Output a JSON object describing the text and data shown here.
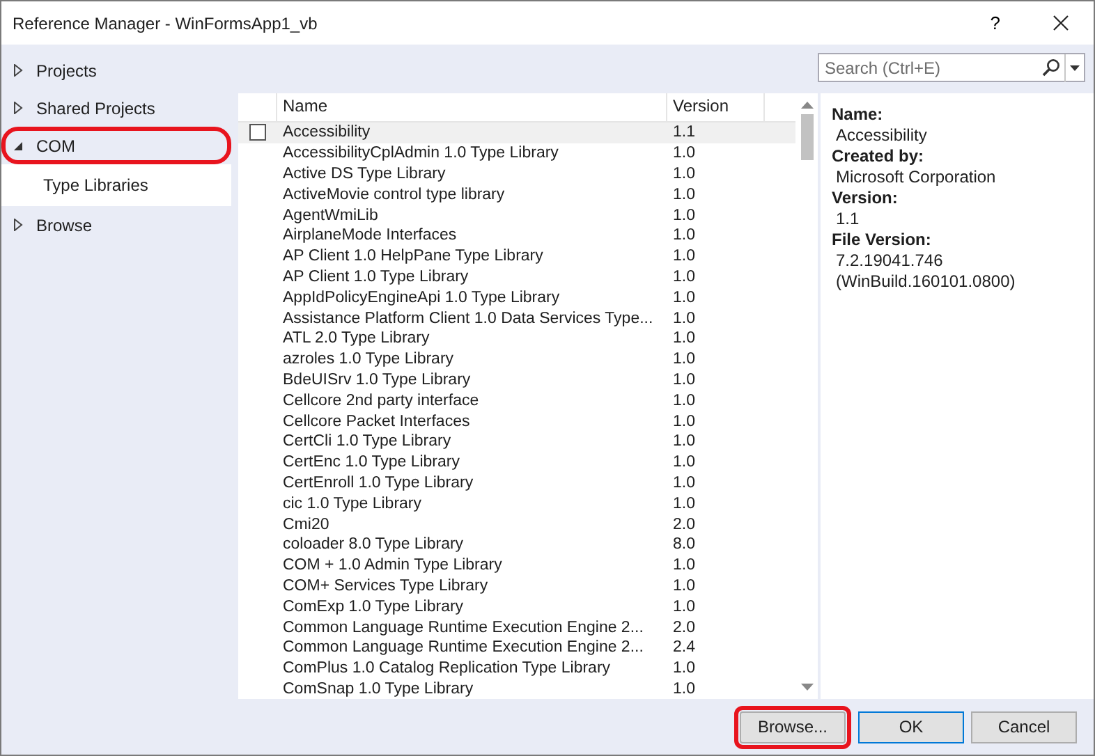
{
  "window": {
    "title": "Reference Manager - WinFormsApp1_vb",
    "help": "?"
  },
  "sidebar": {
    "items": [
      {
        "label": "Projects",
        "expanded": false,
        "highlighted": false
      },
      {
        "label": "Shared Projects",
        "expanded": false,
        "highlighted": false
      },
      {
        "label": "COM",
        "expanded": true,
        "highlighted": true,
        "children": [
          {
            "label": "Type Libraries",
            "selected": true
          }
        ]
      },
      {
        "label": "Browse",
        "expanded": false,
        "highlighted": false
      }
    ]
  },
  "search": {
    "placeholder": "Search (Ctrl+E)"
  },
  "table": {
    "columns": [
      "Name",
      "Version"
    ],
    "rows": [
      {
        "name": "Accessibility",
        "version": "1.1",
        "selected": true
      },
      {
        "name": "AccessibilityCplAdmin 1.0 Type Library",
        "version": "1.0",
        "selected": false
      },
      {
        "name": "Active DS Type Library",
        "version": "1.0",
        "selected": false
      },
      {
        "name": "ActiveMovie control type library",
        "version": "1.0",
        "selected": false
      },
      {
        "name": "AgentWmiLib",
        "version": "1.0",
        "selected": false
      },
      {
        "name": "AirplaneMode Interfaces",
        "version": "1.0",
        "selected": false
      },
      {
        "name": "AP Client 1.0 HelpPane Type Library",
        "version": "1.0",
        "selected": false
      },
      {
        "name": "AP Client 1.0 Type Library",
        "version": "1.0",
        "selected": false
      },
      {
        "name": "AppIdPolicyEngineApi 1.0 Type Library",
        "version": "1.0",
        "selected": false
      },
      {
        "name": "Assistance Platform Client 1.0 Data Services Type...",
        "version": "1.0",
        "selected": false
      },
      {
        "name": "ATL 2.0 Type Library",
        "version": "1.0",
        "selected": false
      },
      {
        "name": "azroles 1.0 Type Library",
        "version": "1.0",
        "selected": false
      },
      {
        "name": "BdeUISrv 1.0 Type Library",
        "version": "1.0",
        "selected": false
      },
      {
        "name": "Cellcore 2nd party interface",
        "version": "1.0",
        "selected": false
      },
      {
        "name": "Cellcore Packet Interfaces",
        "version": "1.0",
        "selected": false
      },
      {
        "name": "CertCli 1.0 Type Library",
        "version": "1.0",
        "selected": false
      },
      {
        "name": "CertEnc 1.0 Type Library",
        "version": "1.0",
        "selected": false
      },
      {
        "name": "CertEnroll 1.0 Type Library",
        "version": "1.0",
        "selected": false
      },
      {
        "name": "cic 1.0 Type Library",
        "version": "1.0",
        "selected": false
      },
      {
        "name": "Cmi20",
        "version": "2.0",
        "selected": false
      },
      {
        "name": "coloader 8.0 Type Library",
        "version": "8.0",
        "selected": false
      },
      {
        "name": "COM + 1.0 Admin Type Library",
        "version": "1.0",
        "selected": false
      },
      {
        "name": "COM+ Services Type Library",
        "version": "1.0",
        "selected": false
      },
      {
        "name": "ComExp 1.0 Type Library",
        "version": "1.0",
        "selected": false
      },
      {
        "name": "Common Language Runtime Execution Engine 2...",
        "version": "2.0",
        "selected": false
      },
      {
        "name": "Common Language Runtime Execution Engine 2...",
        "version": "2.4",
        "selected": false
      },
      {
        "name": "ComPlus 1.0 Catalog Replication Type Library",
        "version": "1.0",
        "selected": false
      },
      {
        "name": "ComSnap 1.0 Type Library",
        "version": "1.0",
        "selected": false
      }
    ]
  },
  "details": [
    {
      "label": "Name:",
      "values": [
        "Accessibility"
      ]
    },
    {
      "label": "Created by:",
      "values": [
        "Microsoft Corporation"
      ]
    },
    {
      "label": "Version:",
      "values": [
        "1.1"
      ]
    },
    {
      "label": "File Version:",
      "values": [
        "7.2.19041.746",
        "(WinBuild.160101.0800)"
      ]
    }
  ],
  "buttons": [
    {
      "label": "Browse...",
      "default": false,
      "highlighted": true
    },
    {
      "label": "OK",
      "default": true,
      "highlighted": false
    },
    {
      "label": "Cancel",
      "default": false,
      "highlighted": false
    }
  ]
}
